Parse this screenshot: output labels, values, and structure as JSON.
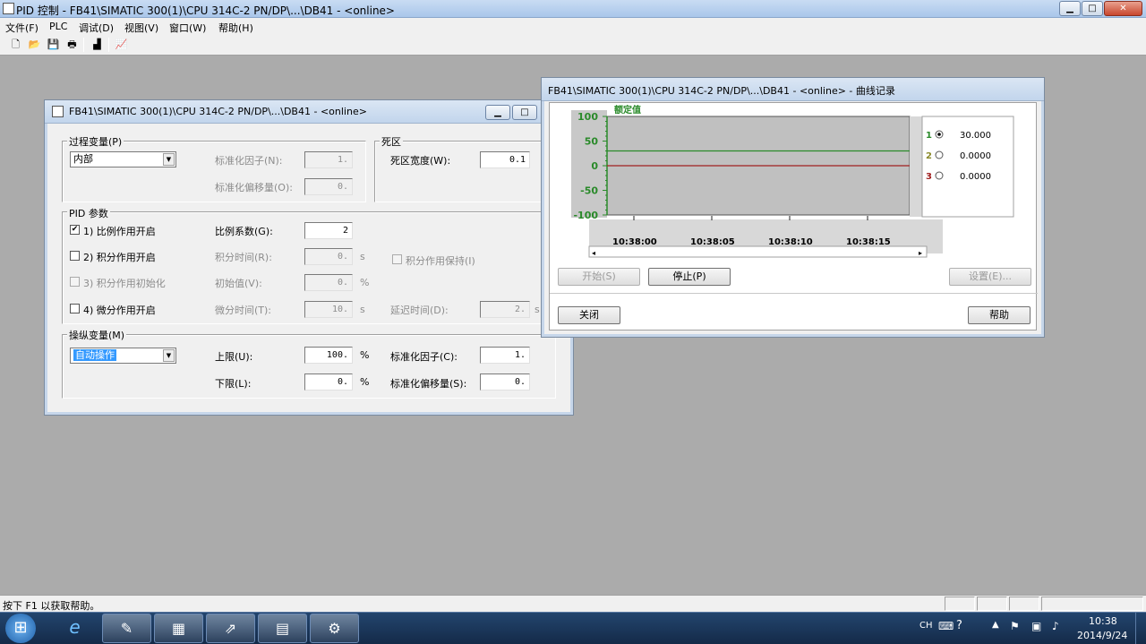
{
  "app": {
    "title": "PID 控制 - FB41\\SIMATIC 300(1)\\CPU 314C-2 PN/DP\\...\\DB41 - <online>",
    "window_buttons": {
      "minimize": "▁",
      "maximize": "□",
      "close": "✕"
    }
  },
  "menu": [
    {
      "label": "文件(F)"
    },
    {
      "label": "PLC"
    },
    {
      "label": "调试(D)"
    },
    {
      "label": "视图(V)"
    },
    {
      "label": "窗口(W)"
    },
    {
      "label": "帮助(H)"
    }
  ],
  "toolbar": {
    "icons": [
      "new-icon",
      "open-icon",
      "save-icon",
      "print-icon",
      "controller-icon",
      "curve-icon"
    ],
    "glyphs": [
      "🗋",
      "📂",
      "💾",
      "🖶",
      "▟",
      "📈"
    ]
  },
  "pid_window": {
    "title": "FB41\\SIMATIC 300(1)\\CPU 314C-2 PN/DP\\...\\DB41 - <online>",
    "process_variable": {
      "group_label": "过程变量(P)",
      "source": "内部",
      "norm_factor_label": "标准化因子(N):",
      "norm_factor_value": "1.",
      "norm_offset_label": "标准化偏移量(O):",
      "norm_offset_value": "0."
    },
    "deadband": {
      "group_label": "死区",
      "width_label": "死区宽度(W):",
      "width_value": "0.1"
    },
    "pid_params": {
      "group_label": "PID 参数",
      "p_enable_label": "1) 比例作用开启",
      "p_enable_checked": "✔",
      "gain_label": "比例系数(G):",
      "gain_value": "2",
      "i_enable_label": "2) 积分作用开启",
      "ti_label": "积分时间(R):",
      "ti_value": "0.",
      "ti_unit": "s",
      "i_hold_label": "积分作用保持(I)",
      "i_init_label": "3) 积分作用初始化",
      "init_label": "初始值(V):",
      "init_value": "0.",
      "init_unit": "%",
      "d_enable_label": "4) 微分作用开启",
      "td_label": "微分时间(T):",
      "td_value": "10.",
      "td_unit": "s",
      "delay_label": "延迟时间(D):",
      "delay_value": "2.",
      "delay_unit": "s"
    },
    "manipulated_variable": {
      "group_label": "操纵变量(M)",
      "mode": "自动操作",
      "upper_label": "上限(U):",
      "upper_value": "100.",
      "upper_unit": "%",
      "lower_label": "下限(L):",
      "lower_value": "0.",
      "lower_unit": "%",
      "norm_factor_label": "标准化因子(C):",
      "norm_factor_value": "1.",
      "norm_offset_label": "标准化偏移量(S):",
      "norm_offset_value": "0."
    }
  },
  "curve_window": {
    "title": "FB41\\SIMATIC 300(1)\\CPU 314C-2 PN/DP\\...\\DB41 - <online> - 曲线记录",
    "start_label": "开始(S)",
    "stop_label": "停止(P)",
    "settings_label": "设置(E)...",
    "close_label": "关闭",
    "help_label": "帮助",
    "legend": [
      {
        "index": "1",
        "value": "30.000",
        "selected": true,
        "color": "#2a8a2a"
      },
      {
        "index": "2",
        "value": "0.0000",
        "selected": false,
        "color": "#8a8a2a"
      },
      {
        "index": "3",
        "value": "0.0000",
        "selected": false,
        "color": "#a02020"
      }
    ]
  },
  "chart_data": {
    "type": "line",
    "title": "额定值",
    "ylim": [
      -100,
      100
    ],
    "yticks": [
      "100",
      "50",
      "0",
      "-50",
      "-100"
    ],
    "yvalues": [
      100,
      50,
      0,
      -50,
      -100
    ],
    "xticks": [
      "10:38:00",
      "10:38:05",
      "10:38:10",
      "10:38:15"
    ],
    "series": [
      {
        "values": [
          30,
          30
        ],
        "color": "#2a8a2a"
      },
      {
        "values": [
          0,
          0
        ],
        "color": "#a02020"
      }
    ]
  },
  "status": {
    "help_text": "按下 F1 以获取帮助。"
  },
  "taskbar": {
    "apps": [
      "start-orb",
      "ie-icon",
      "simatic-manager-icon",
      "plcsim-icon",
      "pid-tool-icon",
      "hw-config-icon",
      "netpro-icon"
    ],
    "glyphs": [
      "⊞",
      "e",
      "✎",
      "▦",
      "⇗",
      "▤",
      "⚙"
    ],
    "lang": "CH",
    "time": "10:38",
    "date": "2014/9/24"
  }
}
